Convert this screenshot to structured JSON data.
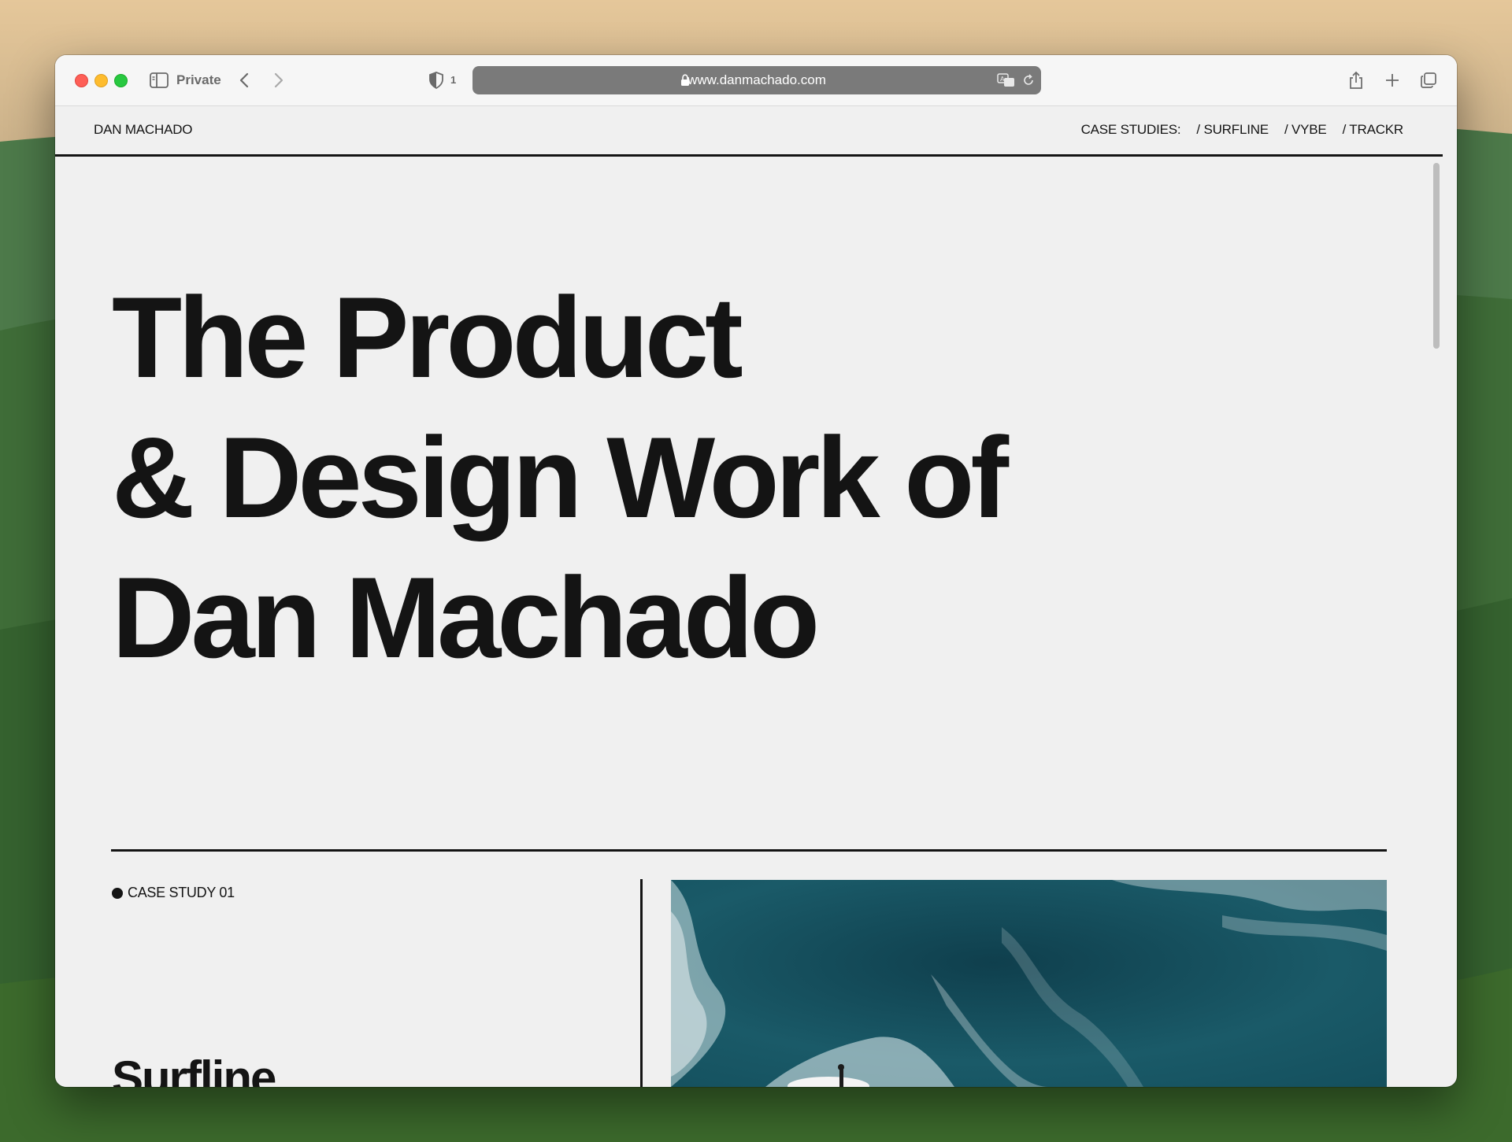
{
  "browser": {
    "private_label": "Private",
    "shield_count": "1",
    "url": "www.danmachado.com"
  },
  "site": {
    "brand": "DAN MACHADO",
    "nav": {
      "prefix": "CASE STUDIES:",
      "links": [
        "/ SURFLINE",
        "/ VYBE",
        "/ TRACKR"
      ]
    },
    "hero": {
      "line1": "The Product",
      "line2": "& Design Work of",
      "line3": "Dan Machado"
    },
    "case_study": {
      "label": "CASE STUDY 01",
      "title": "Surfline"
    }
  },
  "colors": {
    "text": "#141414",
    "page_bg": "#f0f0f0",
    "ocean": "#1d5866"
  }
}
